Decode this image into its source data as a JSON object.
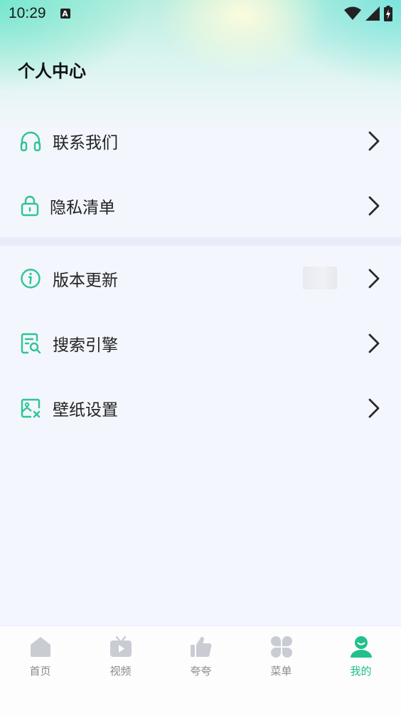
{
  "status_bar": {
    "time": "10:29",
    "notification_icon_letter": "A"
  },
  "page": {
    "title": "个人中心"
  },
  "menu_group_1": [
    {
      "label": "联系我们",
      "icon": "headset-icon"
    },
    {
      "label": "隐私清单",
      "icon": "lock-icon"
    }
  ],
  "menu_group_2": [
    {
      "label": "版本更新",
      "icon": "info-icon"
    },
    {
      "label": "搜索引擎",
      "icon": "search-doc-icon"
    },
    {
      "label": "壁纸设置",
      "icon": "wallpaper-icon"
    }
  ],
  "tabbar": [
    {
      "label": "首页",
      "icon": "home-icon",
      "active": false
    },
    {
      "label": "视频",
      "icon": "tv-icon",
      "active": false
    },
    {
      "label": "夸夸",
      "icon": "thumbs-up-icon",
      "active": false
    },
    {
      "label": "菜单",
      "icon": "grid-icon",
      "active": false
    },
    {
      "label": "我的",
      "icon": "user-icon",
      "active": true
    }
  ],
  "colors": {
    "accent": "#22c08a",
    "background": "#f3f6fd",
    "divider": "#e9ecf8",
    "inactive": "#c9ccd3"
  }
}
